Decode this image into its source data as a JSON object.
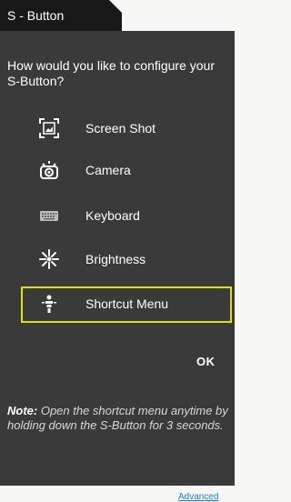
{
  "window": {
    "tab_title": "S - Button"
  },
  "dialog": {
    "prompt": "How would you like to configure your S-Button?",
    "options": [
      {
        "label": "Screen Shot",
        "icon": "screenshot-icon",
        "selected": false
      },
      {
        "label": "Camera",
        "icon": "camera-icon",
        "selected": false
      },
      {
        "label": "Keyboard",
        "icon": "keyboard-icon",
        "selected": false
      },
      {
        "label": "Brightness",
        "icon": "brightness-icon",
        "selected": false
      },
      {
        "label": "Shortcut Menu",
        "icon": "shortcut-menu-icon",
        "selected": true
      }
    ],
    "ok_label": "OK",
    "note_label": "Note:",
    "note_text": " Open the shortcut menu anytime by holding down the S-Button for 3 seconds.",
    "advanced_link": "Advanced"
  },
  "colors": {
    "panel_bg": "#3a3a3a",
    "tab_bg": "#191919",
    "selection_border": "#e2e000",
    "link": "#1e7ee8",
    "text": "#ffffff"
  }
}
